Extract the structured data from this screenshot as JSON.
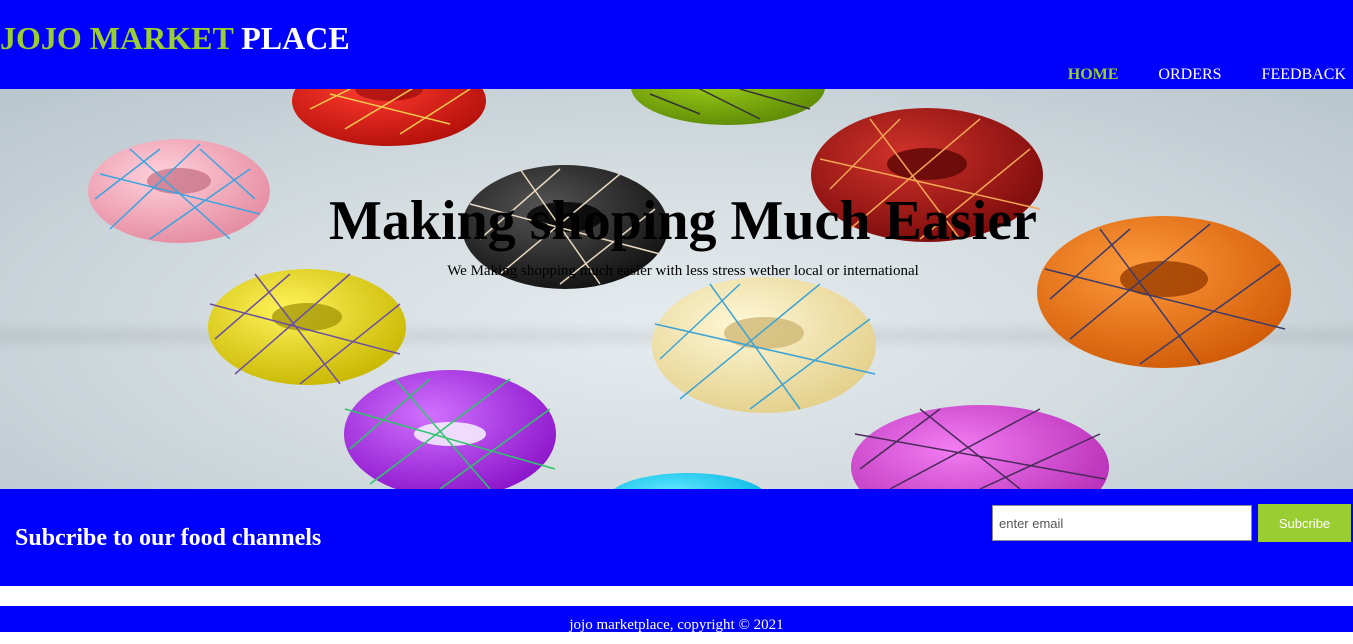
{
  "header": {
    "brand": "JOJO MARKET",
    "brand_rest": "PLACE",
    "nav": [
      {
        "label": "HOME",
        "active": true
      },
      {
        "label": "ORDERS",
        "active": false
      },
      {
        "label": "FEEDBACK",
        "active": false
      }
    ]
  },
  "hero": {
    "title": "Making shoping Much Easier",
    "subtitle": "We Making shopping much easier with less stress wether local or international",
    "image": "donuts-illustration"
  },
  "subscribe": {
    "title": "Subcribe to our food channels",
    "email_placeholder": "enter email",
    "email_value": "",
    "button_label": "Subcribe"
  },
  "footer": {
    "text": "jojo marketplace, copyright © 2021"
  },
  "colors": {
    "primary": "#0000ff",
    "accent": "#9acd32",
    "text_light": "#ffffff"
  }
}
